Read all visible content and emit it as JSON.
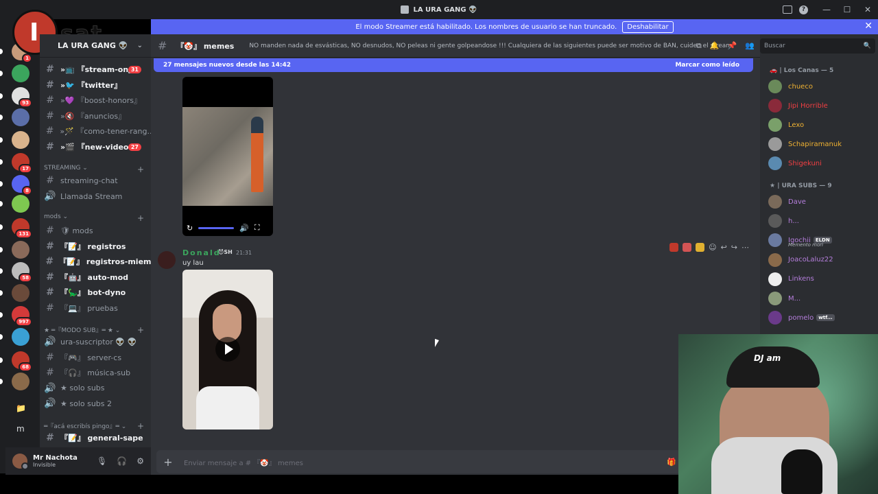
{
  "window": {
    "title": "LA URA GANG 👽",
    "controls": [
      "—",
      "☐",
      "✕"
    ]
  },
  "banner": {
    "text": "El modo Streamer está habilitado. Los nombres de usuario se han truncado.",
    "button": "Deshabilitar"
  },
  "logo": {
    "text": "sat"
  },
  "servers": [
    {
      "badge": "1",
      "color": "#c89b7b"
    },
    {
      "badge": "",
      "color": "#3ba55d"
    },
    {
      "badge": "93",
      "color": "#e0e0e0"
    },
    {
      "badge": "",
      "color": "#5b6ea8"
    },
    {
      "badge": "",
      "color": "#d9b38c"
    },
    {
      "badge": "17",
      "color": "#c0392b"
    },
    {
      "badge": "8",
      "color": "#5865f2"
    },
    {
      "badge": "",
      "color": "#7ec850"
    },
    {
      "badge": "131",
      "color": "#c0392b"
    },
    {
      "badge": "",
      "color": "#8a6a5a"
    },
    {
      "badge": "58",
      "color": "#bdbdbd"
    },
    {
      "badge": "",
      "color": "#6a4a3a"
    },
    {
      "badge": "997",
      "color": "#d43a3a"
    },
    {
      "badge": "",
      "color": "#3aa0d4"
    },
    {
      "badge": "68",
      "color": "#c0392b"
    },
    {
      "badge": "",
      "color": "#8a6a4a"
    }
  ],
  "server_extras": {
    "folder": "📁",
    "m": "m"
  },
  "guild": {
    "name": "LA URA GANG 👽"
  },
  "channels": [
    {
      "label": "『stream-on』",
      "icon": "»📺",
      "unread": true,
      "count": "31"
    },
    {
      "label": "『twitter』",
      "icon": "»🐦",
      "unread": true,
      "count": ""
    },
    {
      "label": "『boost-honors』",
      "icon": "»💜",
      "unread": false,
      "count": ""
    },
    {
      "label": "『anuncios』",
      "icon": "»🔇",
      "unread": false,
      "count": ""
    },
    {
      "label": "『como-tener-rang...",
      "icon": "»🪄",
      "unread": false,
      "count": ""
    },
    {
      "label": "『new-videos』",
      "icon": "»🎬",
      "unread": true,
      "count": "27"
    }
  ],
  "categories": {
    "streaming": "STREAMING",
    "mods": "mods",
    "modo_sub": "★ ═『MODO SUB』═ ★",
    "aca": "═『acá escribís pingo』═"
  },
  "streaming_channels": [
    {
      "label": "streaming-chat",
      "type": "#"
    },
    {
      "label": "Llamada Stream",
      "type": "🔊"
    }
  ],
  "mods_channels": [
    {
      "label": "mods",
      "icon": "🛡",
      "unread": false
    },
    {
      "label": "registros",
      "icon": "『📝』",
      "unread": true
    },
    {
      "label": "registros-miem...",
      "icon": "『📝』",
      "unread": true
    },
    {
      "label": "auto-mod",
      "icon": "『🤖』",
      "unread": true
    },
    {
      "label": "bot-dyno",
      "icon": "『🦕』",
      "unread": true
    },
    {
      "label": "pruebas",
      "icon": "『💻』",
      "unread": false
    }
  ],
  "sub_channels": [
    {
      "label": "ura-suscriptor 👽 👽",
      "type": "🔊"
    },
    {
      "label": "『🎮』 server-cs",
      "type": "#"
    },
    {
      "label": "『🎧』 música-sub",
      "type": "#"
    },
    {
      "label": "★ solo subs",
      "type": "🔊"
    },
    {
      "label": "★ solo subs 2",
      "type": "🔊"
    }
  ],
  "general_channel": {
    "label": "『📝』 general-sape"
  },
  "user": {
    "name": "Mr Nachota",
    "status": "Invisible"
  },
  "chat": {
    "channel_name": "『🤡』 memes",
    "topic": "NO manden nada de esvásticas, NO desnudos, NO peleas ni gente golpeandose !!! Cualquiera de las siguientes puede ser motivo de BAN, cuiden el stream!",
    "new_messages": "27 mensajes nuevos desde las 14:42",
    "mark_read": "Marcar como leído",
    "message": {
      "author": "Donald",
      "tag": "😈SH",
      "time": "21:31",
      "text": "uy lau"
    },
    "composer_placeholder": "Enviar mensaje a # 『🤡』 memes"
  },
  "search": {
    "placeholder": "Buscar"
  },
  "members": {
    "group1": "🚗 | Los Canas — 5",
    "group1_list": [
      {
        "name": "chueco",
        "color": "#f0b232"
      },
      {
        "name": "Jipi Horrible",
        "color": "#f23f43"
      },
      {
        "name": "Lexo",
        "color": "#f0b232"
      },
      {
        "name": "Schapiramanuk",
        "color": "#f0b232"
      },
      {
        "name": "Shigekuni",
        "color": "#f23f43"
      }
    ],
    "group2": "★ | URA SUBS — 9",
    "group2_list": [
      {
        "name": "Dave",
        "color": "#b57edc",
        "extra": "",
        "sub": ""
      },
      {
        "name": "h...",
        "color": "#b57edc",
        "extra": "",
        "sub": ""
      },
      {
        "name": "Igochii",
        "color": "#b57edc",
        "extra": "ELDN",
        "sub": "Memento mori"
      },
      {
        "name": "JoacoLaluz22",
        "color": "#b57edc",
        "extra": "",
        "sub": ""
      },
      {
        "name": "Linkens",
        "color": "#b57edc",
        "extra": "",
        "sub": ""
      },
      {
        "name": "M...",
        "color": "#b57edc",
        "extra": "",
        "sub": ""
      },
      {
        "name": "pomelo",
        "color": "#b57edc",
        "extra": "wtf...",
        "sub": ""
      }
    ]
  },
  "webcam": {
    "cap_text": "DJ am"
  }
}
